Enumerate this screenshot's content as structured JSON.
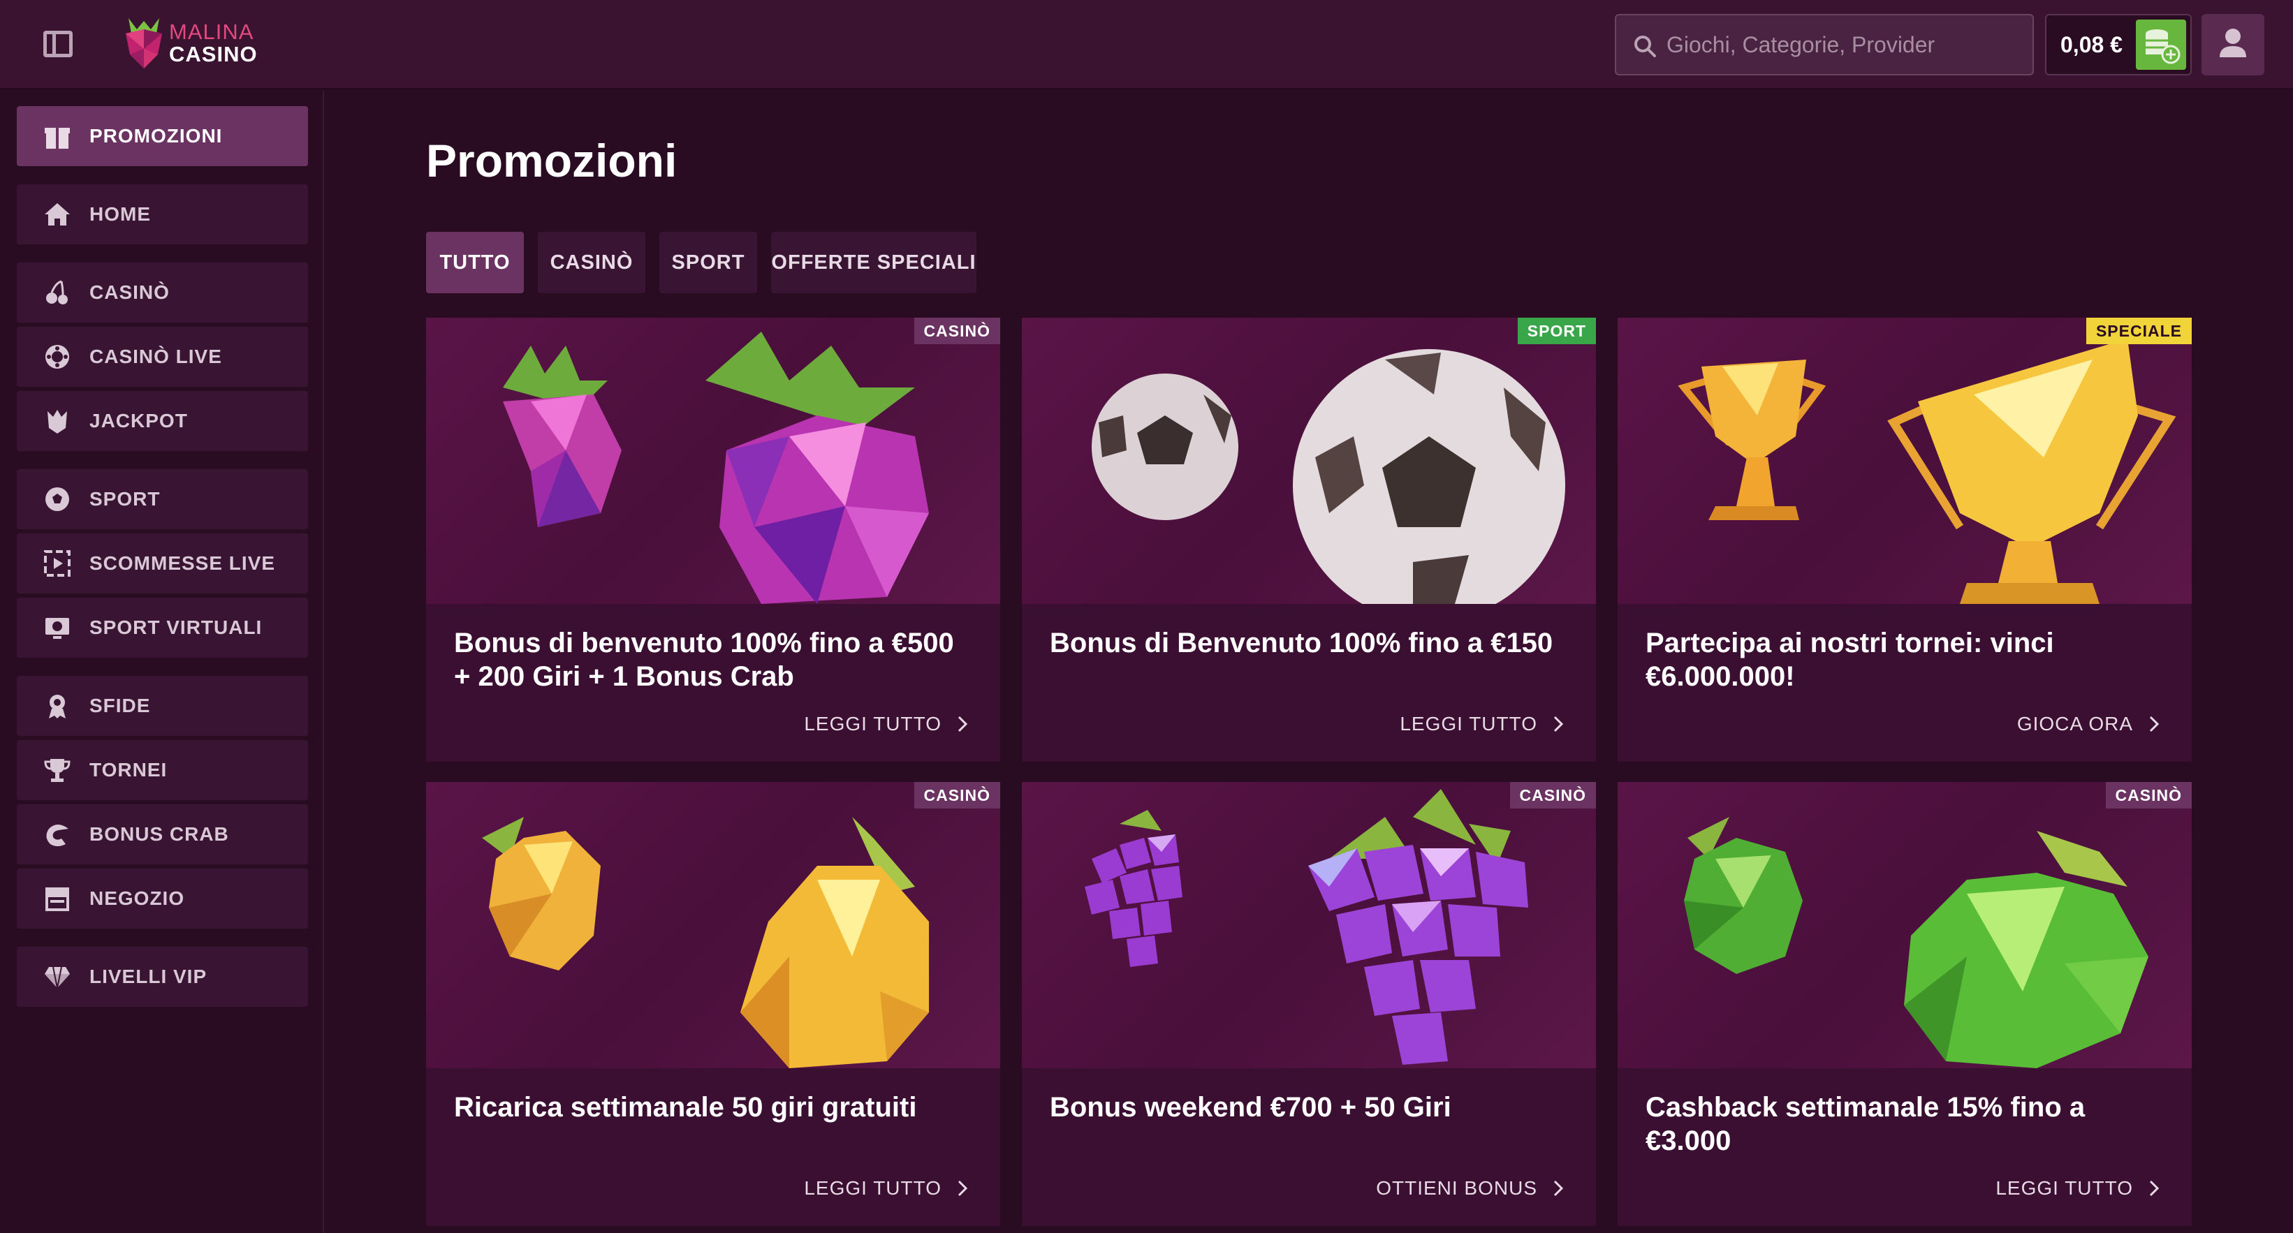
{
  "header": {
    "logo_line1": "MALINA",
    "logo_line2": "CASINO",
    "search_placeholder": "Giochi, Categorie, Provider",
    "balance": "0,08 €"
  },
  "sidebar": {
    "items": [
      {
        "label": "PROMOZIONI",
        "icon": "gift-icon",
        "active": true
      },
      {
        "label": "HOME",
        "icon": "home-icon"
      },
      {
        "label": "CASINÒ",
        "icon": "cherries-icon"
      },
      {
        "label": "CASINÒ LIVE",
        "icon": "chip-icon"
      },
      {
        "label": "JACKPOT",
        "icon": "jackpot-icon"
      },
      {
        "label": "SPORT",
        "icon": "football-icon"
      },
      {
        "label": "SCOMMESSE LIVE",
        "icon": "live-bets-icon"
      },
      {
        "label": "SPORT VIRTUALI",
        "icon": "virtual-sports-icon"
      },
      {
        "label": "SFIDE",
        "icon": "medal-icon"
      },
      {
        "label": "TORNEI",
        "icon": "trophy-icon"
      },
      {
        "label": "BONUS CRAB",
        "icon": "crab-icon"
      },
      {
        "label": "NEGOZIO",
        "icon": "shop-icon"
      },
      {
        "label": "LIVELLI VIP",
        "icon": "diamond-icon"
      }
    ]
  },
  "main": {
    "title": "Promozioni",
    "tabs": [
      {
        "label": "TUTTO",
        "active": true
      },
      {
        "label": "CASINÒ"
      },
      {
        "label": "SPORT"
      },
      {
        "label": "OFFERTE SPECIALI"
      }
    ],
    "cards": [
      {
        "badge": "CASINÒ",
        "title": "Bonus di benvenuto 100% fino a €500 + 200 Giri + 1 Bonus Crab",
        "link": "LEGGI TUTTO",
        "art": "raspberry"
      },
      {
        "badge": "SPORT",
        "title": "Bonus di Benvenuto 100% fino a €150",
        "link": "LEGGI TUTTO",
        "art": "football"
      },
      {
        "badge": "SPECIALE",
        "title": "Partecipa ai nostri tornei: vinci €6.000.000!",
        "link": "GIOCA ORA",
        "art": "trophy"
      },
      {
        "badge": "CASINÒ",
        "title": "Ricarica settimanale 50 giri gratuiti",
        "link": "LEGGI TUTTO",
        "art": "lemon"
      },
      {
        "badge": "CASINÒ",
        "title": "Bonus weekend €700 + 50 Giri",
        "link": "OTTIENI BONUS",
        "art": "grapes"
      },
      {
        "badge": "CASINÒ",
        "title": "Cashback settimanale 15% fino a €3.000",
        "link": "LEGGI TUTTO",
        "art": "apple"
      }
    ]
  },
  "colors": {
    "background": "#2a0c22",
    "topbar": "#3a1331",
    "active": "#6a3361",
    "badge_casino": "#6a3361",
    "badge_sport": "#3aa64a",
    "badge_special": "#f0d43a",
    "deposit": "#67b63d"
  }
}
